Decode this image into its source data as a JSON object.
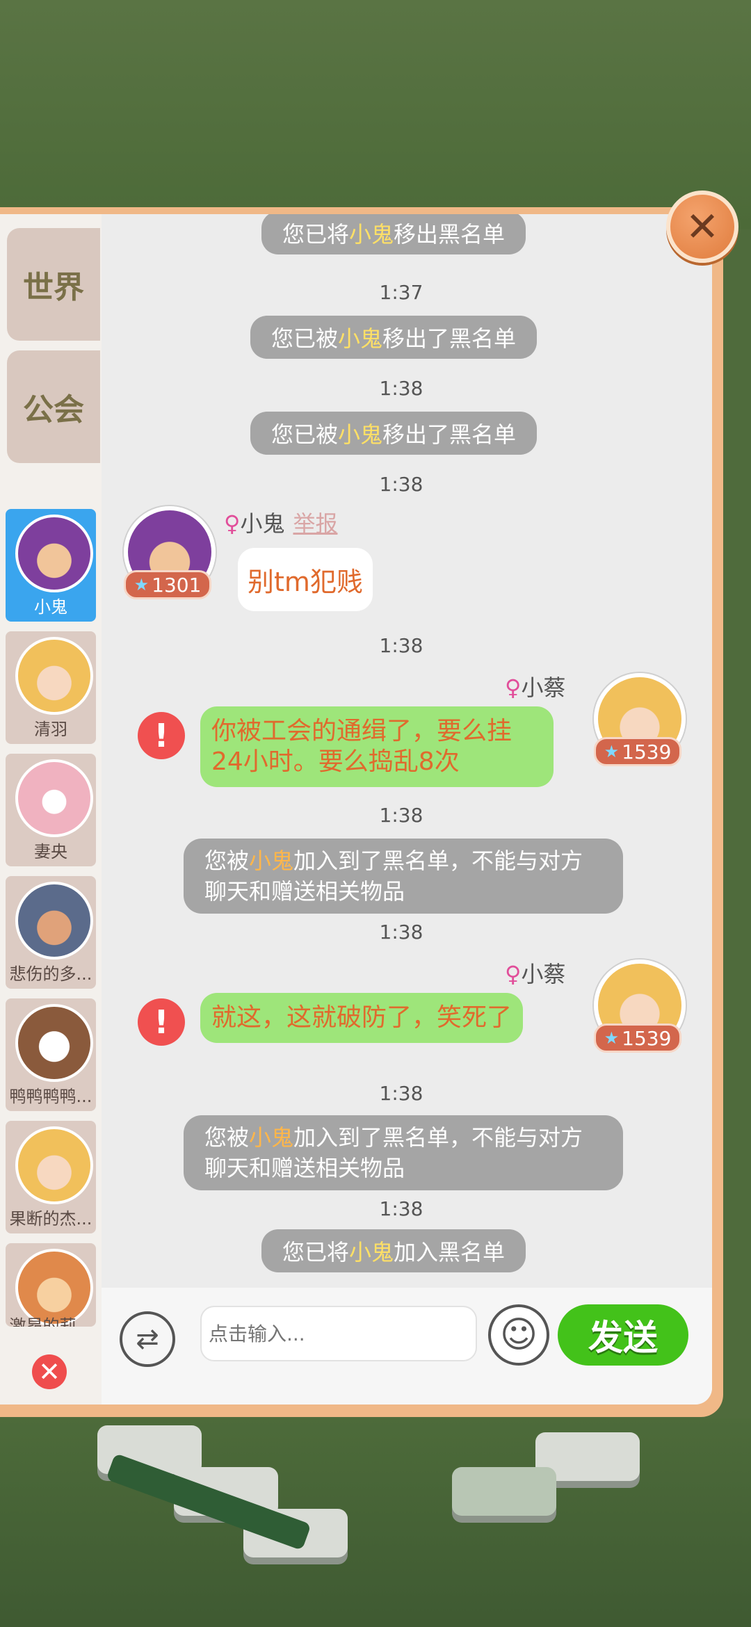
{
  "sidebar": {
    "tabs": [
      {
        "label": "世界"
      },
      {
        "label": "公会"
      }
    ],
    "contacts": [
      {
        "name": "小鬼",
        "active": true,
        "color": "#7e3f9d"
      },
      {
        "name": "清羽",
        "active": false,
        "color": "#f1c05b"
      },
      {
        "name": "妻央",
        "active": false,
        "color": "#f0b2c0"
      },
      {
        "name": "悲伤的多...",
        "active": false,
        "color": "#5b6b8b"
      },
      {
        "name": "鸭鸭鸭鸭...",
        "active": false,
        "color": "#8a5a3c"
      },
      {
        "name": "果断的杰...",
        "active": false,
        "color": "#f1c05b"
      },
      {
        "name": "激昂的莉...",
        "active": false,
        "color": "#e0894b"
      }
    ]
  },
  "messages": {
    "sys0": {
      "pre": "您已将",
      "name": "小鬼",
      "post": "移出黑名单"
    },
    "t1": "1:37",
    "sys1": {
      "pre": "您已被",
      "name": "小鬼",
      "post": "移出了黑名单"
    },
    "t2": "1:38",
    "sys2": {
      "pre": "您已被",
      "name": "小鬼",
      "post": "移出了黑名单"
    },
    "t3": "1:38",
    "msg1": {
      "gender": "♀",
      "sender": "小鬼",
      "report": "举报",
      "level": "1301",
      "text": "别tm犯贱"
    },
    "t4": "1:38",
    "msg2": {
      "gender": "♀",
      "sender": "小蔡",
      "level": "1539",
      "text": "你被工会的通缉了，要么挂24小时。要么捣乱8次"
    },
    "t5": "1:38",
    "sys3": {
      "pre": "您被",
      "name": "小鬼",
      "post": "加入到了黑名单，不能与对方聊天和赠送相关物品"
    },
    "t6": "1:38",
    "msg3": {
      "gender": "♀",
      "sender": "小蔡",
      "level": "1539",
      "text": "就这，这就破防了，笑死了"
    },
    "t7": "1:38",
    "sys4": {
      "pre": "您被",
      "name": "小鬼",
      "post": "加入到了黑名单，不能与对方聊天和赠送相关物品"
    },
    "t8": "1:38",
    "sys5": {
      "pre": "您已将",
      "name": "小鬼",
      "post": "加入黑名单"
    }
  },
  "input": {
    "placeholder": "点击输入...",
    "send_label": "发送"
  },
  "colors": {
    "accent_send": "#43c21a",
    "highlight_name": "#ffe066",
    "panel_border": "#f0b887"
  }
}
